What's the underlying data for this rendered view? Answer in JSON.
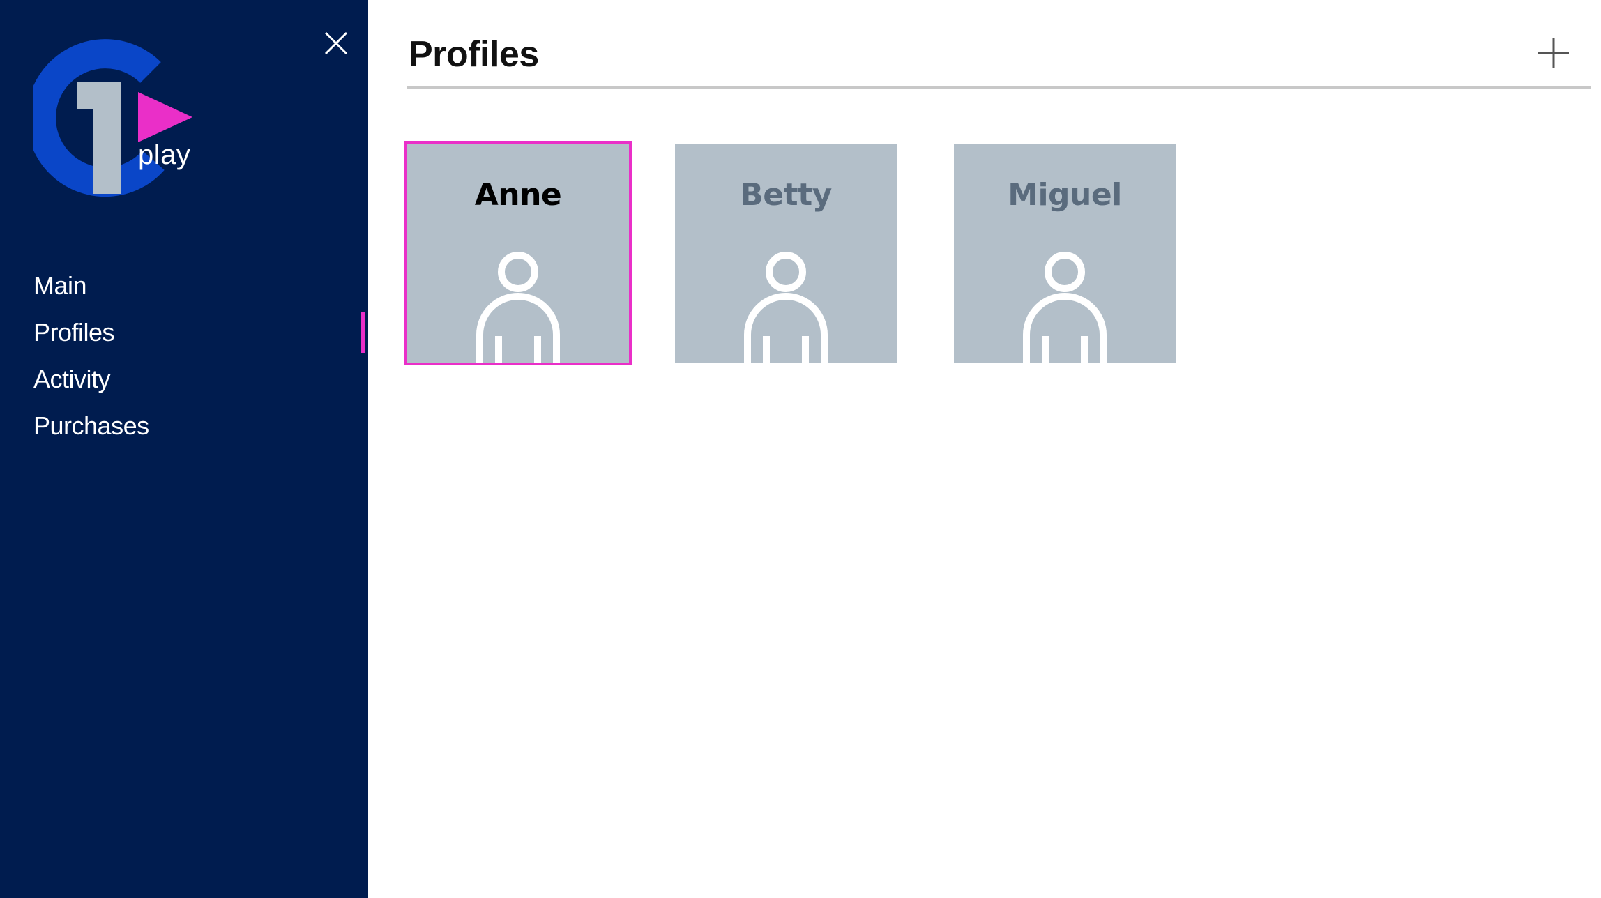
{
  "app": {
    "logo_text": "play",
    "brand_colors": {
      "navy": "#001c4f",
      "accent": "#ea2fc8",
      "blue": "#0a46c8",
      "gray": "#b3bfc9"
    }
  },
  "sidebar": {
    "close_icon": "close-icon",
    "items": [
      {
        "label": "Main",
        "active": false
      },
      {
        "label": "Profiles",
        "active": true
      },
      {
        "label": "Activity",
        "active": false
      },
      {
        "label": "Purchases",
        "active": false
      }
    ]
  },
  "header": {
    "title": "Profiles",
    "add_icon": "plus-icon"
  },
  "profiles": [
    {
      "name": "Anne",
      "selected": true,
      "icon": "user-icon"
    },
    {
      "name": "Betty",
      "selected": false,
      "icon": "user-icon"
    },
    {
      "name": "Miguel",
      "selected": false,
      "icon": "user-icon"
    }
  ]
}
